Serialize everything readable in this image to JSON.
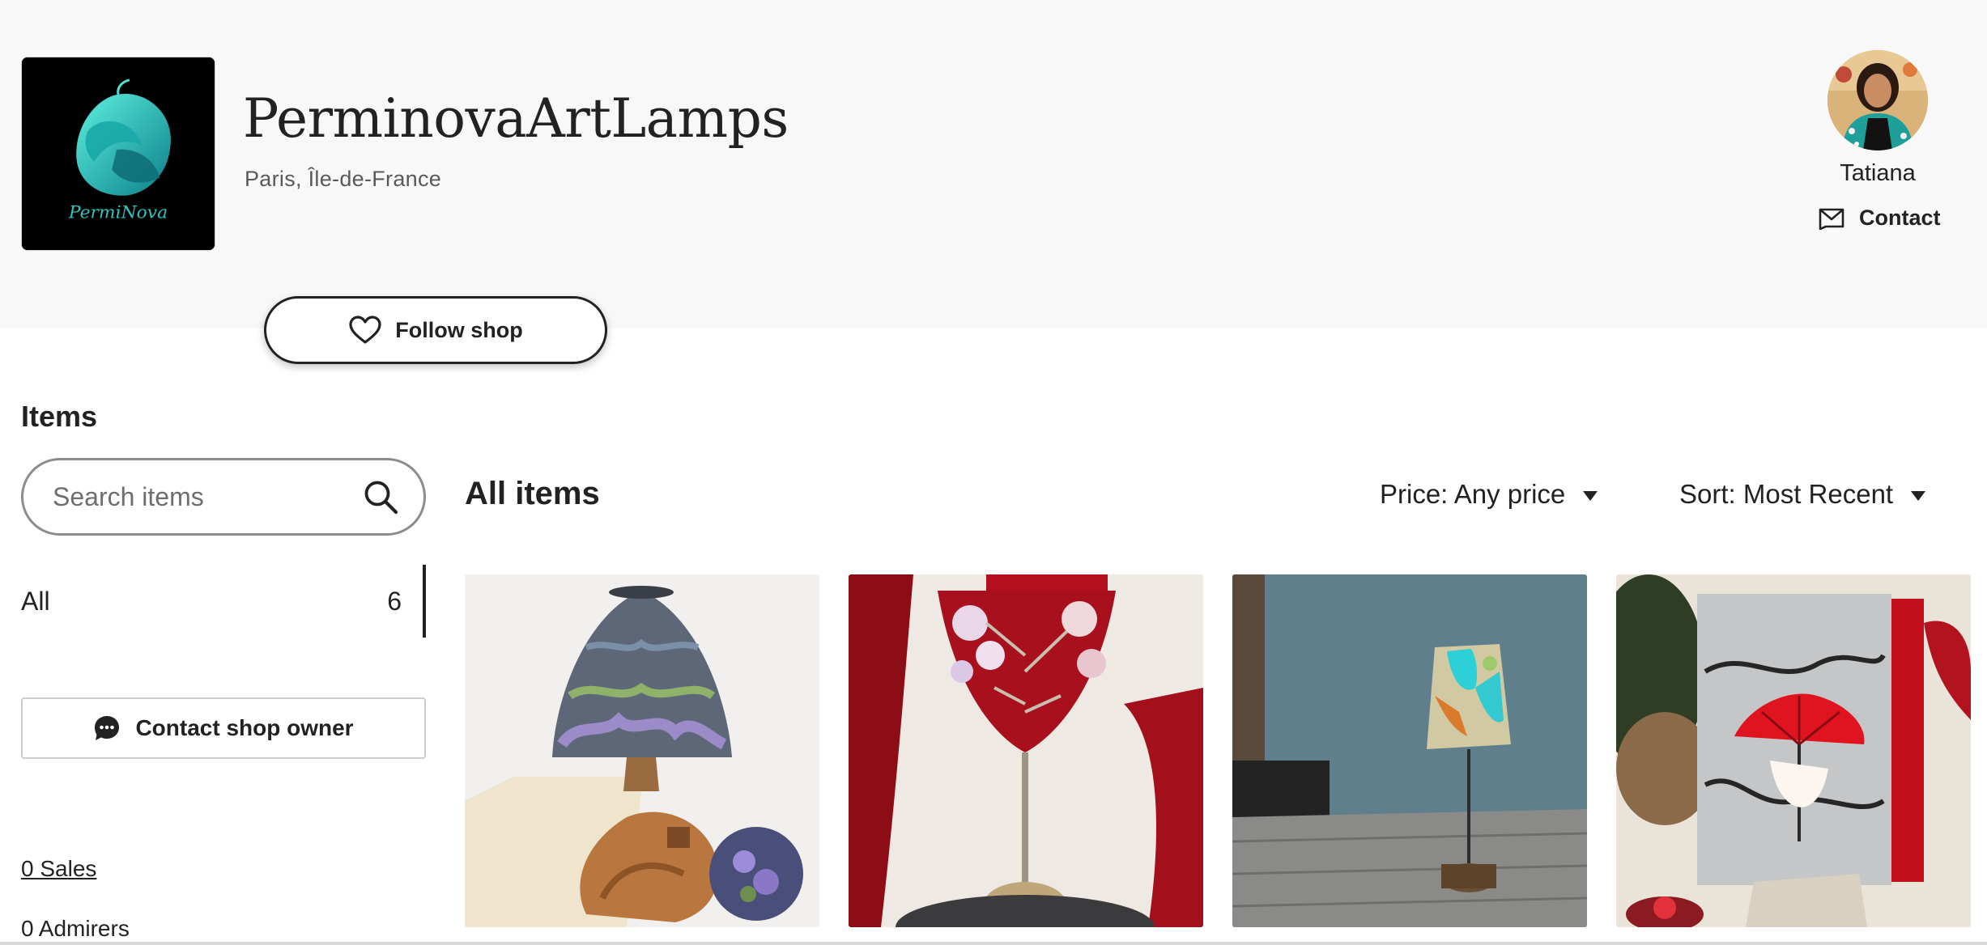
{
  "shop": {
    "name": "PerminovaArtLamps",
    "location": "Paris, Île-de-France",
    "logo_text": "PermiNova",
    "follow_label": "Follow shop"
  },
  "owner": {
    "name": "Tatiana",
    "contact_label": "Contact"
  },
  "sidebar": {
    "items_heading": "Items",
    "search_placeholder": "Search items",
    "sections": [
      {
        "label": "All",
        "count": "6"
      }
    ],
    "contact_owner_label": "Contact shop owner",
    "sales": "0 Sales",
    "admirers": "0 Admirers"
  },
  "main": {
    "heading": "All items",
    "price_filter": "Price: Any price",
    "sort_filter": "Sort: Most Recent"
  },
  "listings": [
    {
      "image": "wisteria-stained-glass-lamp"
    },
    {
      "image": "red-flower-stained-glass-lamp"
    },
    {
      "image": "turquoise-shade-table-lamp"
    },
    {
      "image": "red-umbrella-glass-lamp"
    }
  ],
  "colors": {
    "header_bg": "#f8f8f8",
    "text": "#222222",
    "logo_teal": "#1fc7c0",
    "muted": "#595959"
  },
  "icons": [
    "heart-icon",
    "mail-icon",
    "search-icon",
    "chat-bubble-icon",
    "caret-down-icon"
  ]
}
